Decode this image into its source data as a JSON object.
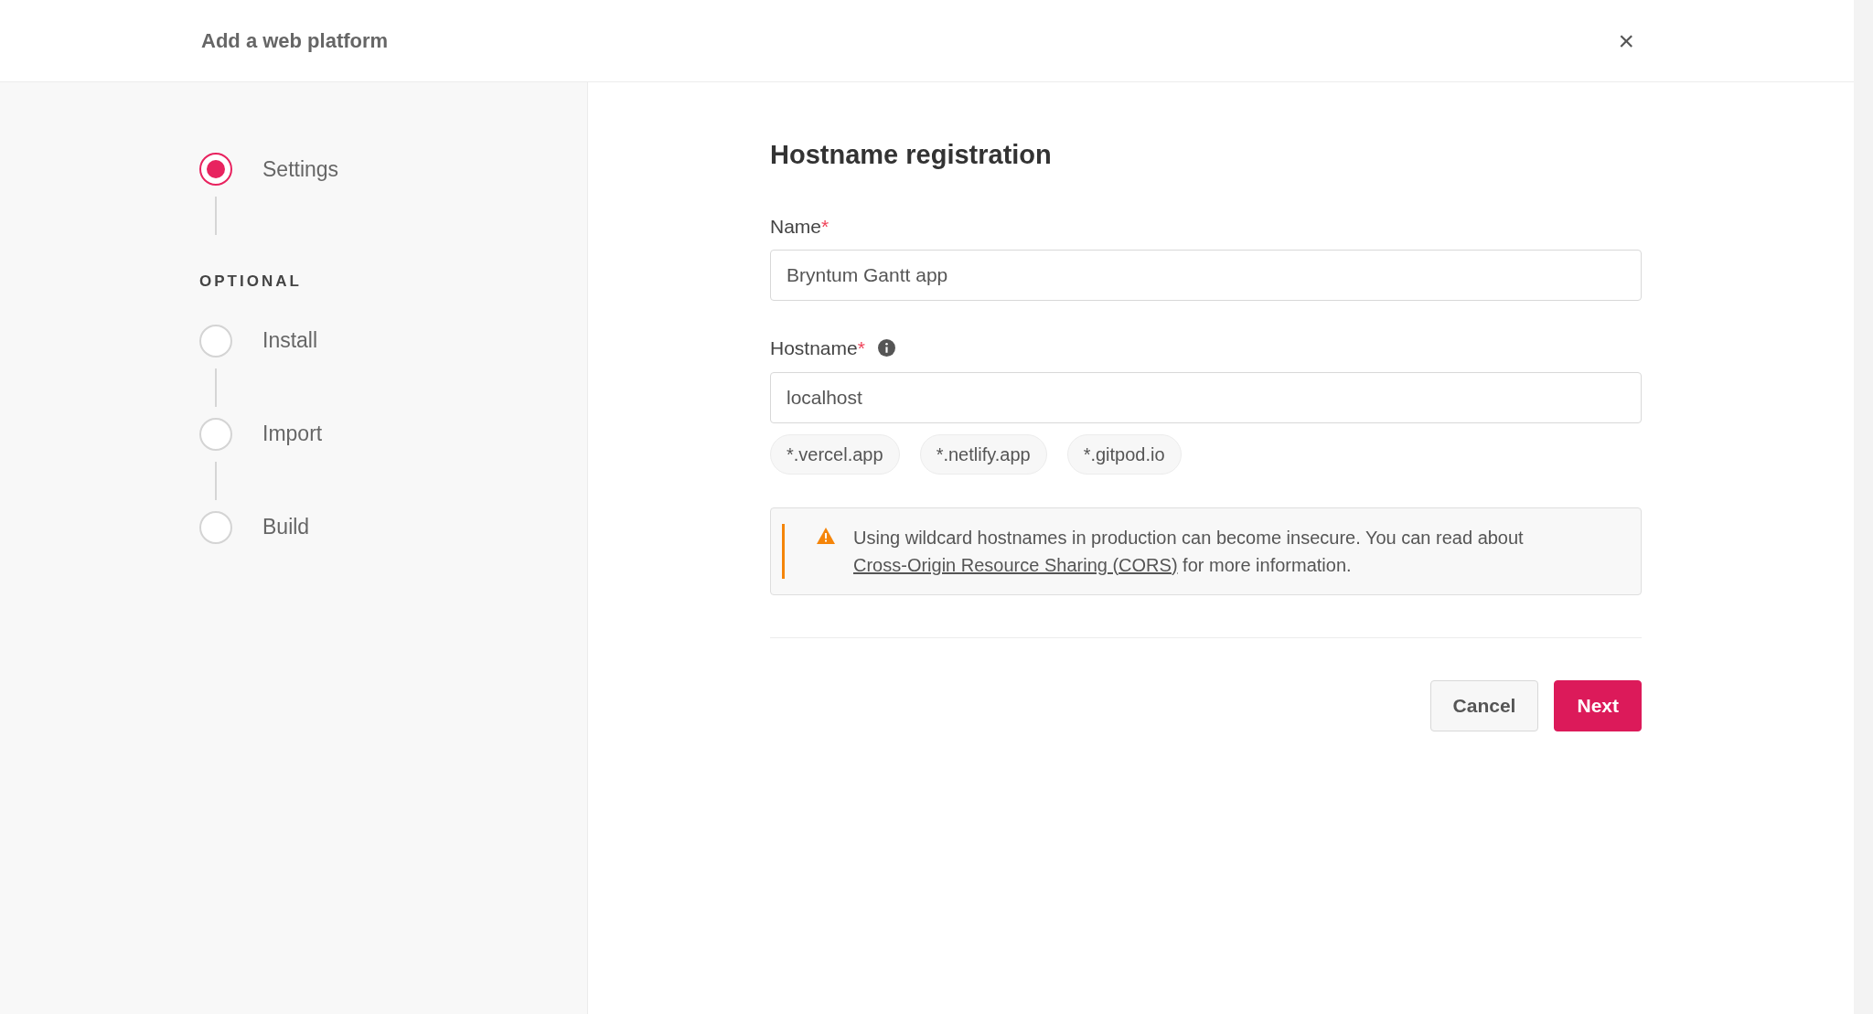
{
  "header": {
    "title": "Add a web platform",
    "close": "×"
  },
  "steps": [
    {
      "label": "Settings",
      "selected": true
    }
  ],
  "optional": {
    "heading": "OPTIONAL",
    "steps": [
      {
        "label": "Install",
        "selected": false
      },
      {
        "label": "Import",
        "selected": false
      },
      {
        "label": "Build",
        "selected": false
      }
    ]
  },
  "form": {
    "heading": "Hostname registration",
    "fields": [
      {
        "label": "Name",
        "required": "*",
        "info": false,
        "value": "Bryntum Gantt app"
      },
      {
        "label": "Hostname",
        "required": "*",
        "info": true,
        "value": "localhost"
      }
    ],
    "suggestions": [
      "*.vercel.app",
      "*.netlify.app",
      "*.gitpod.io"
    ],
    "warning": {
      "text": "Using wildcard hostnames in production can become insecure. You can read about",
      "link": "Cross-Origin Resource Sharing (CORS)",
      "text_after": "for more information."
    },
    "buttons": [
      {
        "label": "Cancel",
        "kind": "secondary"
      },
      {
        "label": "Next",
        "kind": "primary"
      }
    ]
  }
}
